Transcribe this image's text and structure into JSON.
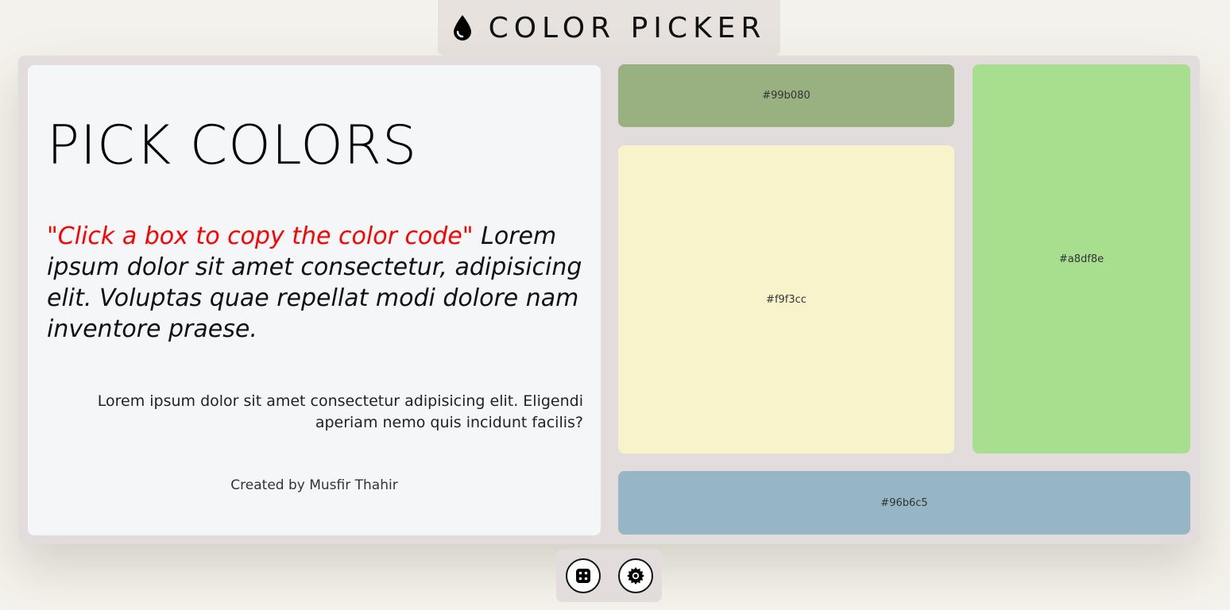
{
  "header": {
    "title": "COLOR PICKER",
    "icon": "drop-icon"
  },
  "card": {
    "heading": "PICK COLORS",
    "quote_red": "\"Click a box to copy the color code\"",
    "quote_rest": " Lorem ipsum dolor sit amet consectetur, adipisicing elit. Voluptas quae repellat modi dolore nam inventore praese.",
    "paragraph": "Lorem ipsum dolor sit amet consectetur adipisicing elit. Eligendi aperiam nemo quis incidunt facilis?",
    "credit": "Created by Musfir Thahir"
  },
  "swatches": [
    {
      "code": "#99b080",
      "color": "#99b080"
    },
    {
      "code": "#f9f3cc",
      "color": "#f9f3cc"
    },
    {
      "code": "#a8df8e",
      "color": "#a8df8e"
    },
    {
      "code": "#96b6c5",
      "color": "#96b6c5"
    }
  ],
  "footer": {
    "buttons": [
      {
        "icon": "dice-icon"
      },
      {
        "icon": "gear-icon"
      }
    ]
  },
  "colors": {
    "background": "#f4f2ec",
    "panel": "#e3dcdc",
    "card": "#f5f6f8",
    "accent_red": "#ff0000"
  }
}
